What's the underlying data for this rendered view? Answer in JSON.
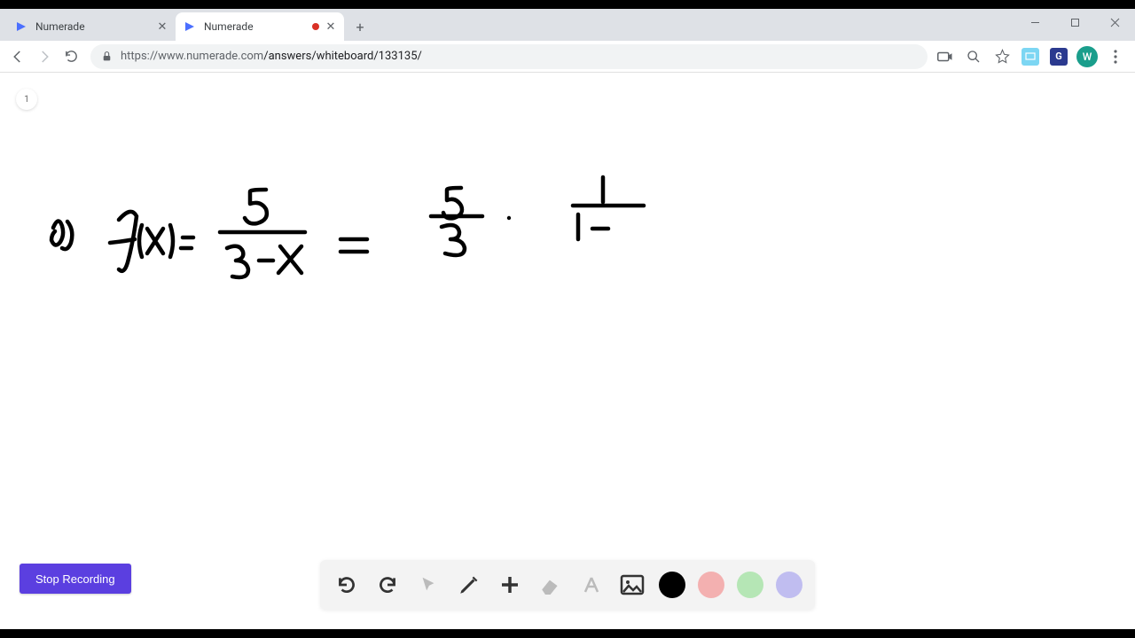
{
  "tabs": [
    {
      "title": "Numerade",
      "active": false
    },
    {
      "title": "Numerade",
      "active": true,
      "recording": true
    }
  ],
  "url": {
    "host": "https://www.numerade.com",
    "path": "/answers/whiteboard/133135/"
  },
  "page_indicator": "1",
  "stop_button": "Stop Recording",
  "colors": {
    "black": "#000000",
    "pink": "#f3b0b0",
    "green": "#b5e6b5",
    "purple": "#c0bdf0"
  },
  "avatar_initial": "W",
  "grammarly_initial": "G",
  "handwriting_description": "a) f(x) = 5 / (3 - x) = (5/3) · 1/(1 - )"
}
